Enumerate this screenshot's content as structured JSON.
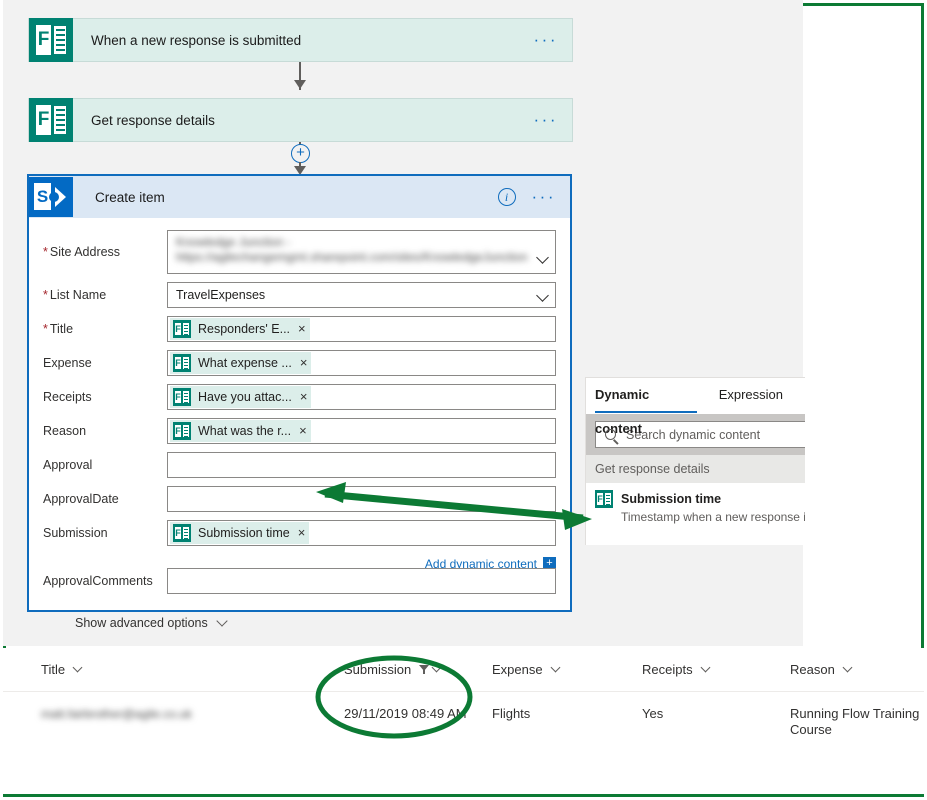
{
  "flow": {
    "trigger": {
      "title": "When a new response is submitted",
      "icon": "microsoft-forms-icon",
      "menu": "···"
    },
    "action1": {
      "title": "Get response details",
      "icon": "microsoft-forms-icon",
      "menu": "···"
    },
    "insert_step": "+"
  },
  "create_item": {
    "title": "Create item",
    "icon": "sharepoint-icon",
    "info": "i",
    "menu": "···",
    "fields": [
      {
        "label": "Site Address",
        "required": true,
        "type": "dropdown",
        "value": "",
        "redacted": true,
        "redacted_text": "Knowledge Junction - https://agilechangemgmt.sharepoint.com/sites/KnowledgeJunction"
      },
      {
        "label": "List Name",
        "required": true,
        "type": "dropdown",
        "value": "TravelExpenses"
      },
      {
        "label": "Title",
        "required": true,
        "type": "token",
        "token": "Responders' E...",
        "token_icon": "microsoft-forms-icon",
        "remove": "×"
      },
      {
        "label": "Expense",
        "required": false,
        "type": "token",
        "token": "What expense ...",
        "token_icon": "microsoft-forms-icon",
        "remove": "×"
      },
      {
        "label": "Receipts",
        "required": false,
        "type": "token",
        "token": "Have you attac...",
        "token_icon": "microsoft-forms-icon",
        "remove": "×"
      },
      {
        "label": "Reason",
        "required": false,
        "type": "token",
        "token": "What was the r...",
        "token_icon": "microsoft-forms-icon",
        "remove": "×"
      },
      {
        "label": "Approval",
        "required": false,
        "type": "text",
        "value": ""
      },
      {
        "label": "ApprovalDate",
        "required": false,
        "type": "text",
        "value": ""
      },
      {
        "label": "Submission",
        "required": false,
        "type": "token",
        "token": "Submission time",
        "token_icon": "microsoft-forms-icon",
        "remove": "×"
      },
      {
        "label": "ApprovalComments",
        "required": false,
        "type": "text",
        "value": ""
      }
    ],
    "add_dynamic_content": "Add dynamic content",
    "add_dynamic_plus": "+",
    "show_advanced_options": "Show advanced options"
  },
  "dynamic_panel": {
    "tabs": [
      {
        "label": "Dynamic content",
        "active": true
      },
      {
        "label": "Expression",
        "active": false
      }
    ],
    "search_placeholder": "Search dynamic content",
    "search_icon": "search-icon",
    "group_label": "Get response details",
    "items": [
      {
        "name": "Submission time",
        "description": "Timestamp when a new response is s",
        "icon": "microsoft-forms-icon"
      }
    ]
  },
  "list_table": {
    "columns": [
      {
        "label": "Title",
        "filtered": false
      },
      {
        "label": "Submission",
        "filtered": true
      },
      {
        "label": "Expense",
        "filtered": false
      },
      {
        "label": "Receipts",
        "filtered": false
      },
      {
        "label": "Reason",
        "filtered": false
      }
    ],
    "rows": [
      {
        "title": "",
        "title_redacted": true,
        "title_redacted_text": "matt.fairbrother@agile.co.uk",
        "submission": "29/11/2019 08:49 AM",
        "expense": "Flights",
        "receipts": "Yes",
        "reason": "Running Flow Training Course"
      }
    ]
  },
  "annotations": {
    "color": "#0c7a34",
    "arrow": "double-headed-arrow-submission-mapping",
    "ellipse": "highlight-ellipse-submission-column",
    "frame": "image-border"
  }
}
